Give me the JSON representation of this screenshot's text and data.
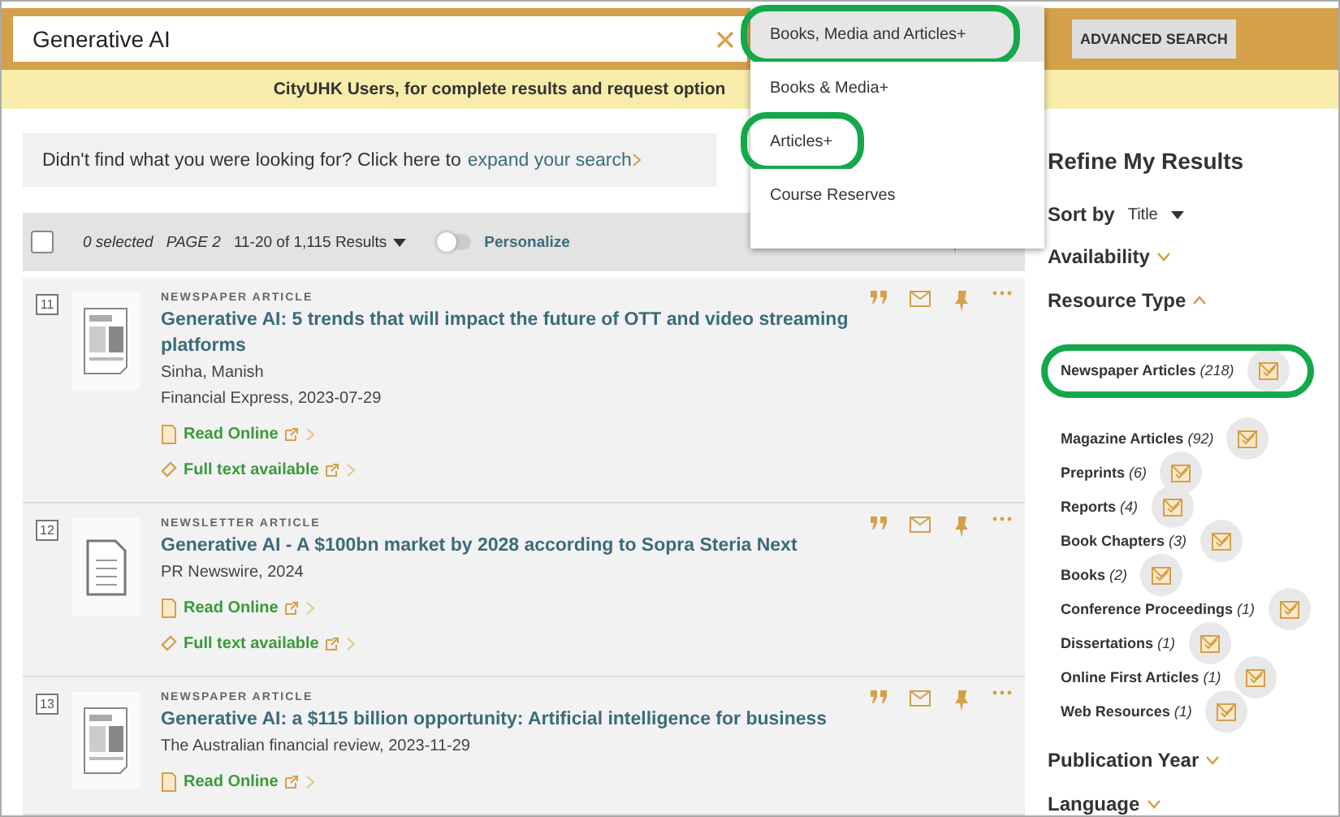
{
  "search": {
    "value": "Generative AI"
  },
  "scope_menu": [
    {
      "label": "Books, Media and Articles+",
      "selected": true,
      "highlighted": true
    },
    {
      "label": "Books & Media+",
      "selected": false,
      "highlighted": false
    },
    {
      "label": "Articles+",
      "selected": false,
      "highlighted": true
    },
    {
      "label": "Course Reserves",
      "selected": false,
      "highlighted": false
    }
  ],
  "advanced_search": "ADVANCED SEARCH",
  "banner": "CityUHK Users, for complete results and request option",
  "expand": {
    "text": "Didn't find what you were looking for? Click here to",
    "link": "expand your search"
  },
  "toolbar": {
    "checked": false,
    "selected_count": "0 selected",
    "page": "PAGE 2",
    "range": "11-20 of 1,115 Results",
    "personalize": {
      "label": "Personalize",
      "on": false
    }
  },
  "results": [
    {
      "number": "11",
      "kind": "news",
      "type": "NEWSPAPER ARTICLE",
      "title": "Generative AI: 5 trends that will impact the future of OTT and video streaming platforms",
      "author": "Sinha, Manish",
      "source": "Financial Express, 2023-07-29",
      "links": [
        {
          "kind": "online",
          "label": "Read Online"
        },
        {
          "kind": "fulltext",
          "label": "Full text available"
        }
      ]
    },
    {
      "number": "12",
      "kind": "document",
      "type": "NEWSLETTER ARTICLE",
      "title": "Generative AI - A $100bn market by 2028 according to Sopra Steria Next",
      "source": "PR Newswire, 2024",
      "links": [
        {
          "kind": "online",
          "label": "Read Online"
        },
        {
          "kind": "fulltext",
          "label": "Full text available"
        }
      ]
    },
    {
      "number": "13",
      "kind": "news",
      "type": "NEWSPAPER ARTICLE",
      "title": "Generative AI: a $115 billion opportunity: Artificial intelligence for business",
      "source": "The Australian financial review, 2023-11-29",
      "links": [
        {
          "kind": "online",
          "label": "Read Online"
        }
      ]
    }
  ],
  "refine": {
    "title": "Refine My Results",
    "sort_label": "Sort by",
    "sort_value": "Title",
    "sections_before": [
      {
        "label": "Availability",
        "expanded": false
      }
    ],
    "resource_type": {
      "label": "Resource Type",
      "expanded": true,
      "items": [
        {
          "kind": "obscured"
        },
        {
          "label": "Newspaper Articles",
          "count": "(218)",
          "highlighted": true
        },
        {
          "kind": "obscured"
        },
        {
          "label": "Magazine Articles",
          "count": "(92)",
          "highlighted": false
        },
        {
          "label": "Preprints",
          "count": "(6)",
          "highlighted": false
        },
        {
          "label": "Reports",
          "count": "(4)",
          "highlighted": false
        },
        {
          "label": "Book Chapters",
          "count": "(3)",
          "highlighted": false
        },
        {
          "label": "Books",
          "count": "(2)",
          "highlighted": false
        },
        {
          "label": "Conference Proceedings",
          "count": "(1)",
          "highlighted": false
        },
        {
          "label": "Dissertations",
          "count": "(1)",
          "highlighted": false
        },
        {
          "label": "Online First Articles",
          "count": "(1)",
          "highlighted": false
        },
        {
          "label": "Web Resources",
          "count": "(1)",
          "highlighted": false
        }
      ]
    },
    "sections_after": [
      {
        "label": "Publication Year",
        "expanded": false
      },
      {
        "label": "Language",
        "expanded": false
      }
    ]
  }
}
